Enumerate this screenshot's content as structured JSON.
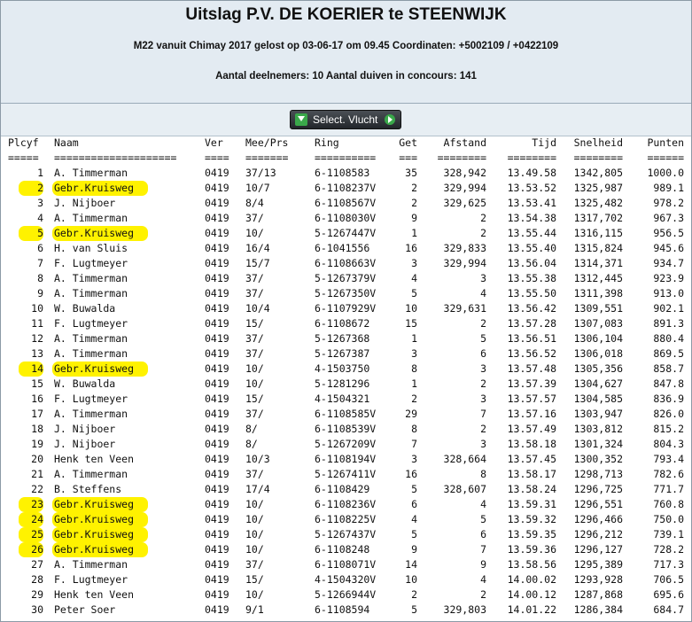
{
  "header": {
    "title": "Uitslag P.V. DE KOERIER te STEENWIJK",
    "info": "M22 vanuit Chimay 2017 gelost op 03-06-17 om 09.45 Coordinaten: +5002109 / +0422109",
    "count": "Aantal deelnemers: 10 Aantal duiven in concours: 141"
  },
  "toolbar": {
    "select_label": "Select. Vlucht"
  },
  "colors": {
    "header_bg": "#e3ebf2",
    "highlight": "#fff200"
  },
  "table": {
    "columns": [
      "Plcyf",
      "Naam",
      "Ver",
      "Mee/Prs",
      "Ring",
      "Get",
      "Afstand",
      "Tijd",
      "Snelheid",
      "Punten"
    ],
    "separators": [
      "=====",
      "====================",
      "====",
      "=======",
      "==========",
      "===",
      "========",
      "========",
      "========",
      "======"
    ],
    "rows": [
      {
        "plcyf": "1",
        "naam": "A. Timmerman",
        "ver": "0419",
        "mee": "37/13",
        "ring": "6-1108583",
        "get": "35",
        "afstand": "328,942",
        "tijd": "13.49.58",
        "snelheid": "1342,805",
        "punten": "1000.0"
      },
      {
        "plcyf": "2",
        "naam": "Gebr.Kruisweg",
        "ver": "0419",
        "mee": "10/7",
        "ring": "6-1108237V",
        "get": "2",
        "afstand": "329,994",
        "tijd": "13.53.52",
        "snelheid": "1325,987",
        "punten": "989.1",
        "hl": true
      },
      {
        "plcyf": "3",
        "naam": "J. Nijboer",
        "ver": "0419",
        "mee": "8/4",
        "ring": "6-1108567V",
        "get": "2",
        "afstand": "329,625",
        "tijd": "13.53.41",
        "snelheid": "1325,482",
        "punten": "978.2"
      },
      {
        "plcyf": "4",
        "naam": "A. Timmerman",
        "ver": "0419",
        "mee": "37/",
        "ring": "6-1108030V",
        "get": "9",
        "afstand": "2",
        "tijd": "13.54.38",
        "snelheid": "1317,702",
        "punten": "967.3"
      },
      {
        "plcyf": "5",
        "naam": "Gebr.Kruisweg",
        "ver": "0419",
        "mee": "10/",
        "ring": "5-1267447V",
        "get": "1",
        "afstand": "2",
        "tijd": "13.55.44",
        "snelheid": "1316,115",
        "punten": "956.5",
        "hl": true
      },
      {
        "plcyf": "6",
        "naam": "H. van Sluis",
        "ver": "0419",
        "mee": "16/4",
        "ring": "6-1041556",
        "get": "16",
        "afstand": "329,833",
        "tijd": "13.55.40",
        "snelheid": "1315,824",
        "punten": "945.6"
      },
      {
        "plcyf": "7",
        "naam": "F. Lugtmeyer",
        "ver": "0419",
        "mee": "15/7",
        "ring": "6-1108663V",
        "get": "3",
        "afstand": "329,994",
        "tijd": "13.56.04",
        "snelheid": "1314,371",
        "punten": "934.7"
      },
      {
        "plcyf": "8",
        "naam": "A. Timmerman",
        "ver": "0419",
        "mee": "37/",
        "ring": "5-1267379V",
        "get": "4",
        "afstand": "3",
        "tijd": "13.55.38",
        "snelheid": "1312,445",
        "punten": "923.9"
      },
      {
        "plcyf": "9",
        "naam": "A. Timmerman",
        "ver": "0419",
        "mee": "37/",
        "ring": "5-1267350V",
        "get": "5",
        "afstand": "4",
        "tijd": "13.55.50",
        "snelheid": "1311,398",
        "punten": "913.0"
      },
      {
        "plcyf": "10",
        "naam": "W. Buwalda",
        "ver": "0419",
        "mee": "10/4",
        "ring": "6-1107929V",
        "get": "10",
        "afstand": "329,631",
        "tijd": "13.56.42",
        "snelheid": "1309,551",
        "punten": "902.1"
      },
      {
        "plcyf": "11",
        "naam": "F. Lugtmeyer",
        "ver": "0419",
        "mee": "15/",
        "ring": "6-1108672",
        "get": "15",
        "afstand": "2",
        "tijd": "13.57.28",
        "snelheid": "1307,083",
        "punten": "891.3"
      },
      {
        "plcyf": "12",
        "naam": "A. Timmerman",
        "ver": "0419",
        "mee": "37/",
        "ring": "5-1267368",
        "get": "1",
        "afstand": "5",
        "tijd": "13.56.51",
        "snelheid": "1306,104",
        "punten": "880.4"
      },
      {
        "plcyf": "13",
        "naam": "A. Timmerman",
        "ver": "0419",
        "mee": "37/",
        "ring": "5-1267387",
        "get": "3",
        "afstand": "6",
        "tijd": "13.56.52",
        "snelheid": "1306,018",
        "punten": "869.5"
      },
      {
        "plcyf": "14",
        "naam": "Gebr.Kruisweg",
        "ver": "0419",
        "mee": "10/",
        "ring": "4-1503750",
        "get": "8",
        "afstand": "3",
        "tijd": "13.57.48",
        "snelheid": "1305,356",
        "punten": "858.7",
        "hl": true
      },
      {
        "plcyf": "15",
        "naam": "W. Buwalda",
        "ver": "0419",
        "mee": "10/",
        "ring": "5-1281296",
        "get": "1",
        "afstand": "2",
        "tijd": "13.57.39",
        "snelheid": "1304,627",
        "punten": "847.8"
      },
      {
        "plcyf": "16",
        "naam": "F. Lugtmeyer",
        "ver": "0419",
        "mee": "15/",
        "ring": "4-1504321",
        "get": "2",
        "afstand": "3",
        "tijd": "13.57.57",
        "snelheid": "1304,585",
        "punten": "836.9"
      },
      {
        "plcyf": "17",
        "naam": "A. Timmerman",
        "ver": "0419",
        "mee": "37/",
        "ring": "6-1108585V",
        "get": "29",
        "afstand": "7",
        "tijd": "13.57.16",
        "snelheid": "1303,947",
        "punten": "826.0"
      },
      {
        "plcyf": "18",
        "naam": "J. Nijboer",
        "ver": "0419",
        "mee": "8/",
        "ring": "6-1108539V",
        "get": "8",
        "afstand": "2",
        "tijd": "13.57.49",
        "snelheid": "1303,812",
        "punten": "815.2"
      },
      {
        "plcyf": "19",
        "naam": "J. Nijboer",
        "ver": "0419",
        "mee": "8/",
        "ring": "5-1267209V",
        "get": "7",
        "afstand": "3",
        "tijd": "13.58.18",
        "snelheid": "1301,324",
        "punten": "804.3"
      },
      {
        "plcyf": "20",
        "naam": "Henk ten Veen",
        "ver": "0419",
        "mee": "10/3",
        "ring": "6-1108194V",
        "get": "3",
        "afstand": "328,664",
        "tijd": "13.57.45",
        "snelheid": "1300,352",
        "punten": "793.4"
      },
      {
        "plcyf": "21",
        "naam": "A. Timmerman",
        "ver": "0419",
        "mee": "37/",
        "ring": "5-1267411V",
        "get": "16",
        "afstand": "8",
        "tijd": "13.58.17",
        "snelheid": "1298,713",
        "punten": "782.6"
      },
      {
        "plcyf": "22",
        "naam": "B. Steffens",
        "ver": "0419",
        "mee": "17/4",
        "ring": "6-1108429",
        "get": "5",
        "afstand": "328,607",
        "tijd": "13.58.24",
        "snelheid": "1296,725",
        "punten": "771.7"
      },
      {
        "plcyf": "23",
        "naam": "Gebr.Kruisweg",
        "ver": "0419",
        "mee": "10/",
        "ring": "6-1108236V",
        "get": "6",
        "afstand": "4",
        "tijd": "13.59.31",
        "snelheid": "1296,551",
        "punten": "760.8",
        "hl": true
      },
      {
        "plcyf": "24",
        "naam": "Gebr.Kruisweg",
        "ver": "0419",
        "mee": "10/",
        "ring": "6-1108225V",
        "get": "4",
        "afstand": "5",
        "tijd": "13.59.32",
        "snelheid": "1296,466",
        "punten": "750.0",
        "hl": true
      },
      {
        "plcyf": "25",
        "naam": "Gebr.Kruisweg",
        "ver": "0419",
        "mee": "10/",
        "ring": "5-1267437V",
        "get": "5",
        "afstand": "6",
        "tijd": "13.59.35",
        "snelheid": "1296,212",
        "punten": "739.1",
        "hl": true
      },
      {
        "plcyf": "26",
        "naam": "Gebr.Kruisweg",
        "ver": "0419",
        "mee": "10/",
        "ring": "6-1108248",
        "get": "9",
        "afstand": "7",
        "tijd": "13.59.36",
        "snelheid": "1296,127",
        "punten": "728.2",
        "hl": true
      },
      {
        "plcyf": "27",
        "naam": "A. Timmerman",
        "ver": "0419",
        "mee": "37/",
        "ring": "6-1108071V",
        "get": "14",
        "afstand": "9",
        "tijd": "13.58.56",
        "snelheid": "1295,389",
        "punten": "717.3"
      },
      {
        "plcyf": "28",
        "naam": "F. Lugtmeyer",
        "ver": "0419",
        "mee": "15/",
        "ring": "4-1504320V",
        "get": "10",
        "afstand": "4",
        "tijd": "14.00.02",
        "snelheid": "1293,928",
        "punten": "706.5"
      },
      {
        "plcyf": "29",
        "naam": "Henk ten Veen",
        "ver": "0419",
        "mee": "10/",
        "ring": "5-1266944V",
        "get": "2",
        "afstand": "2",
        "tijd": "14.00.12",
        "snelheid": "1287,868",
        "punten": "695.6"
      },
      {
        "plcyf": "30",
        "naam": "Peter Soer",
        "ver": "0419",
        "mee": "9/1",
        "ring": "6-1108594",
        "get": "5",
        "afstand": "329,803",
        "tijd": "14.01.22",
        "snelheid": "1286,384",
        "punten": "684.7"
      }
    ]
  }
}
